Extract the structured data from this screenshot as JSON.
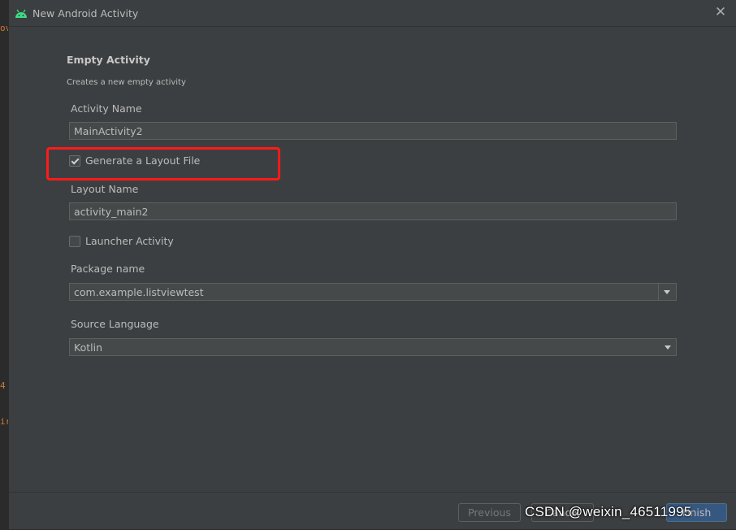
{
  "background_code": {
    "line1": "ov",
    "line2": "4",
    "line3": "ir"
  },
  "window": {
    "title": "New Android Activity",
    "icon": "android-icon",
    "close_icon": "close-icon"
  },
  "template": {
    "heading": "Empty Activity",
    "description": "Creates a new empty activity"
  },
  "form": {
    "activity_name_label": "Activity Name",
    "activity_name_value": "MainActivity2",
    "generate_layout_label": "Generate a Layout File",
    "generate_layout_checked": true,
    "layout_name_label": "Layout Name",
    "layout_name_value": "activity_main2",
    "launcher_activity_label": "Launcher Activity",
    "launcher_activity_checked": false,
    "package_name_label": "Package name",
    "package_name_value": "com.example.listviewtest",
    "source_language_label": "Source Language",
    "source_language_value": "Kotlin"
  },
  "buttons": {
    "previous": "Previous",
    "cancel": "Cancel",
    "finish": "Finish"
  },
  "watermark": "CSDN @weixin_46511995",
  "colors": {
    "highlight": "#ff1a1a",
    "dialog_bg": "#3c3f41",
    "android_green": "#3ddc84",
    "primary_button": "#365880"
  }
}
